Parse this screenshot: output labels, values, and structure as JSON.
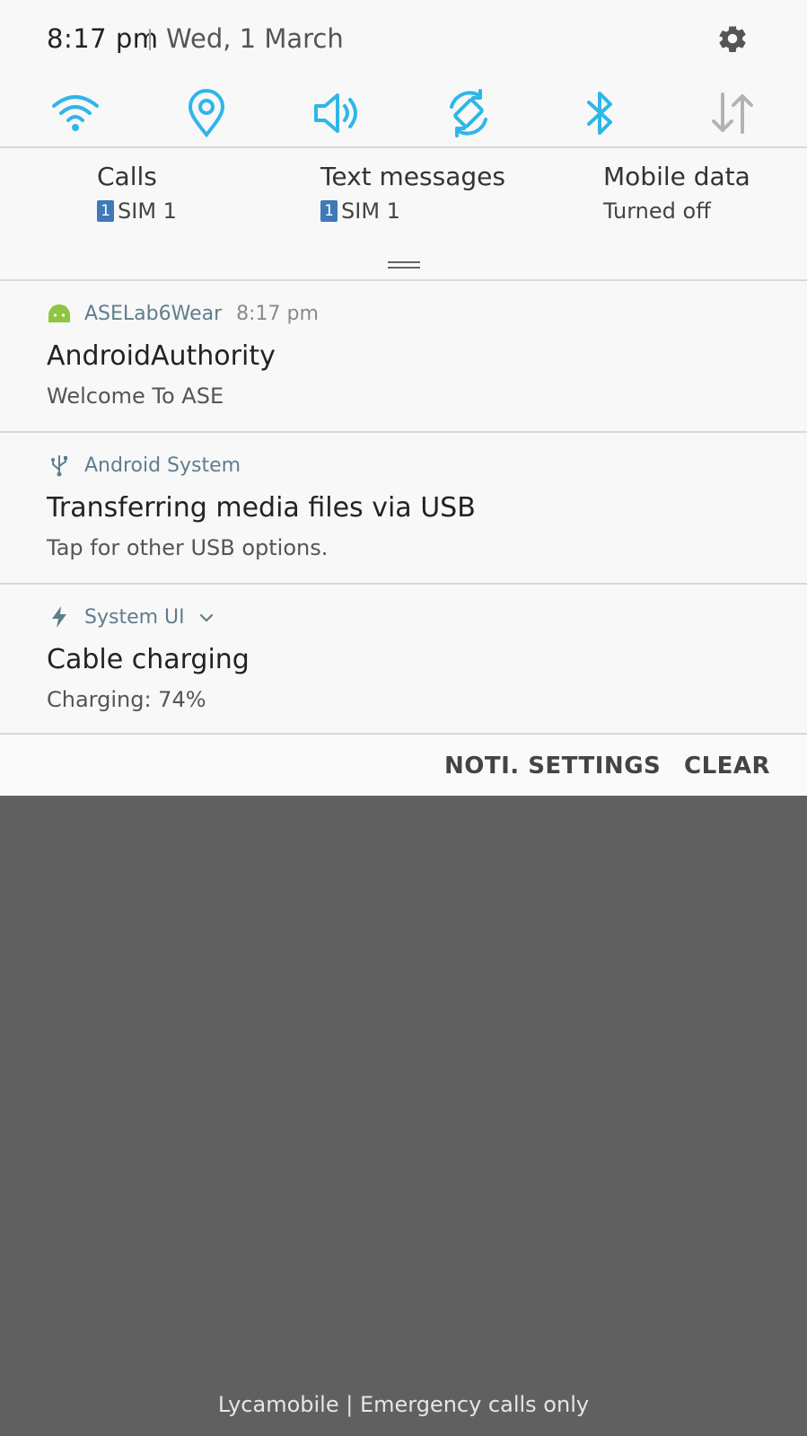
{
  "status": {
    "time": "8:17 pm",
    "date": "Wed, 1 March"
  },
  "quick_settings": [
    {
      "name": "wifi-icon"
    },
    {
      "name": "location-icon"
    },
    {
      "name": "sound-icon"
    },
    {
      "name": "auto-rotate-icon"
    },
    {
      "name": "bluetooth-icon"
    },
    {
      "name": "mobile-data-icon"
    }
  ],
  "sim_info": [
    {
      "title": "Calls",
      "badge": "1",
      "sub": "SIM 1"
    },
    {
      "title": "Text messages",
      "badge": "1",
      "sub": "SIM 1"
    },
    {
      "title": "Mobile data",
      "badge": "",
      "sub": "Turned off"
    }
  ],
  "notifications": [
    {
      "app": "ASELab6Wear",
      "time": "8:17 pm",
      "title": "AndroidAuthority",
      "text": "Welcome To ASE",
      "icon": "android-icon"
    },
    {
      "app": "Android System",
      "time": "",
      "title": "Transferring media files via USB",
      "text": "Tap for other USB options.",
      "icon": "usb-icon"
    },
    {
      "app": "System UI",
      "time": "",
      "title": "Cable charging",
      "text": "Charging: 74%",
      "icon": "charging-icon"
    }
  ],
  "actions": {
    "settings_label": "NOTI. SETTINGS",
    "clear_label": "CLEAR"
  },
  "carrier": "Lycamobile | Emergency calls only",
  "colors": {
    "accent": "#2eb6e8",
    "panel_bg": "#f8f8f9",
    "scrim": "#606060",
    "app_name": "#5f7d8c"
  }
}
